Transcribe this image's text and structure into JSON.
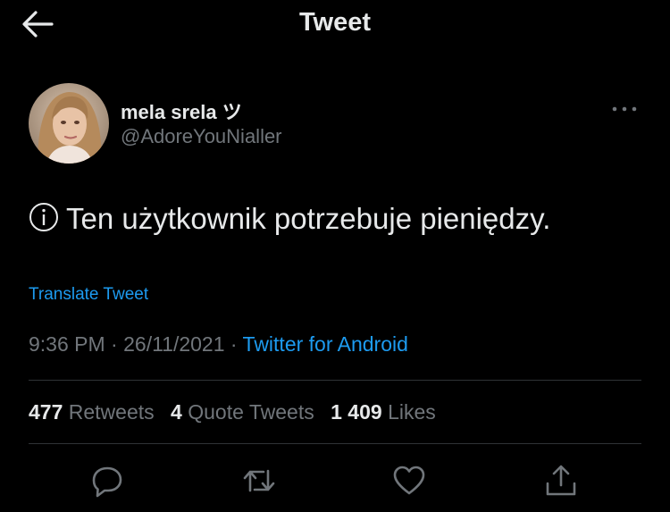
{
  "header": {
    "title": "Tweet",
    "back_icon": "arrow-left-icon"
  },
  "author": {
    "name": "mela srela ツ",
    "handle": "@AdoreYouNialler",
    "more_icon": "more-horizontal-icon"
  },
  "tweet": {
    "text": "Ten użytkownik potrzebuje pieniędzy.",
    "text_icon": "info-circle-icon"
  },
  "translate": {
    "label": "Translate Tweet"
  },
  "meta": {
    "time": "9:36 PM",
    "separator": " · ",
    "date": "26/11/2021",
    "separator2": " · ",
    "source": "Twitter for Android"
  },
  "stats": {
    "retweets": {
      "count": "477",
      "label": "Retweets"
    },
    "quotes": {
      "count": "4",
      "label": "Quote Tweets"
    },
    "likes": {
      "count": "1 409",
      "label": "Likes"
    }
  },
  "actions": [
    {
      "icon": "reply-icon"
    },
    {
      "icon": "retweet-icon"
    },
    {
      "icon": "like-heart-icon"
    },
    {
      "icon": "share-icon"
    }
  ],
  "colors": {
    "background": "#000000",
    "text_primary": "#e7e9ea",
    "text_secondary": "#71767b",
    "accent": "#1d9bf0",
    "divider": "#2f3336"
  }
}
